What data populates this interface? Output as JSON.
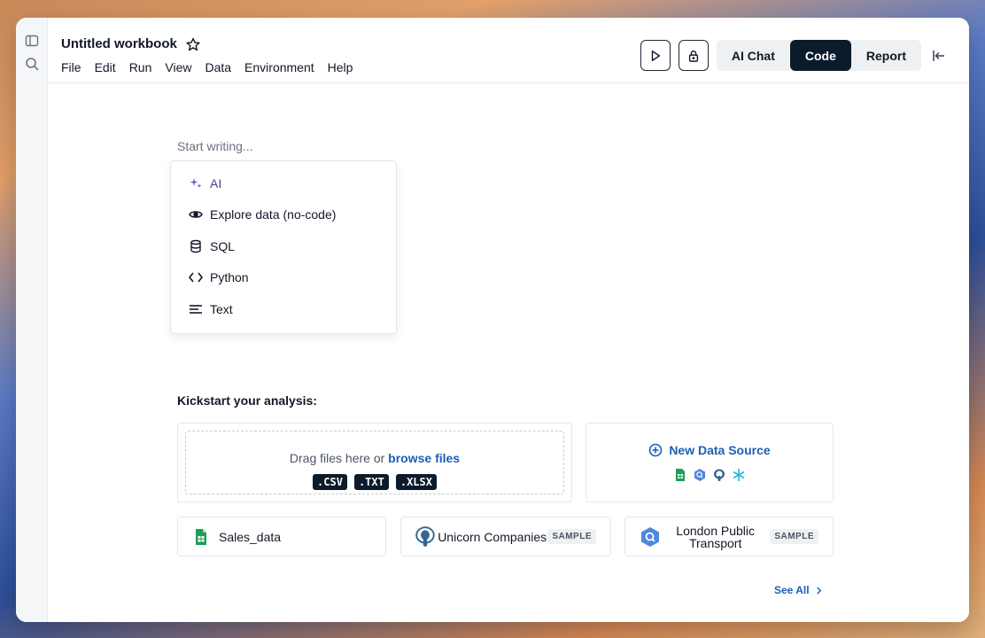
{
  "header": {
    "title": "Untitled workbook",
    "menu": [
      "File",
      "Edit",
      "Run",
      "View",
      "Data",
      "Environment",
      "Help"
    ],
    "modes": {
      "ai_chat": "AI Chat",
      "code": "Code",
      "report": "Report"
    },
    "active_mode": "Code"
  },
  "editor": {
    "placeholder": "Start writing...",
    "dropdown": [
      {
        "label": "AI",
        "icon": "sparkle-icon"
      },
      {
        "label": "Explore data (no-code)",
        "icon": "eye-icon"
      },
      {
        "label": "SQL",
        "icon": "database-icon"
      },
      {
        "label": "Python",
        "icon": "code-brackets-icon"
      },
      {
        "label": "Text",
        "icon": "text-lines-icon"
      }
    ]
  },
  "kickstart": {
    "heading": "Kickstart your analysis:",
    "upload": {
      "text": "Drag files here or",
      "link": "browse files",
      "formats": [
        ".CSV",
        ".TXT",
        ".XLSX"
      ]
    },
    "new_source": {
      "label": "New Data Source"
    },
    "sources": [
      {
        "label": "Sales_data",
        "badge": ""
      },
      {
        "label": "Unicorn Companies",
        "badge": "SAMPLE"
      },
      {
        "label": "London Public Transport",
        "badge": "SAMPLE"
      }
    ],
    "see_all": "See All"
  },
  "colors": {
    "accent": "#1d5fb5",
    "active_bg": "#0b1b2b"
  }
}
